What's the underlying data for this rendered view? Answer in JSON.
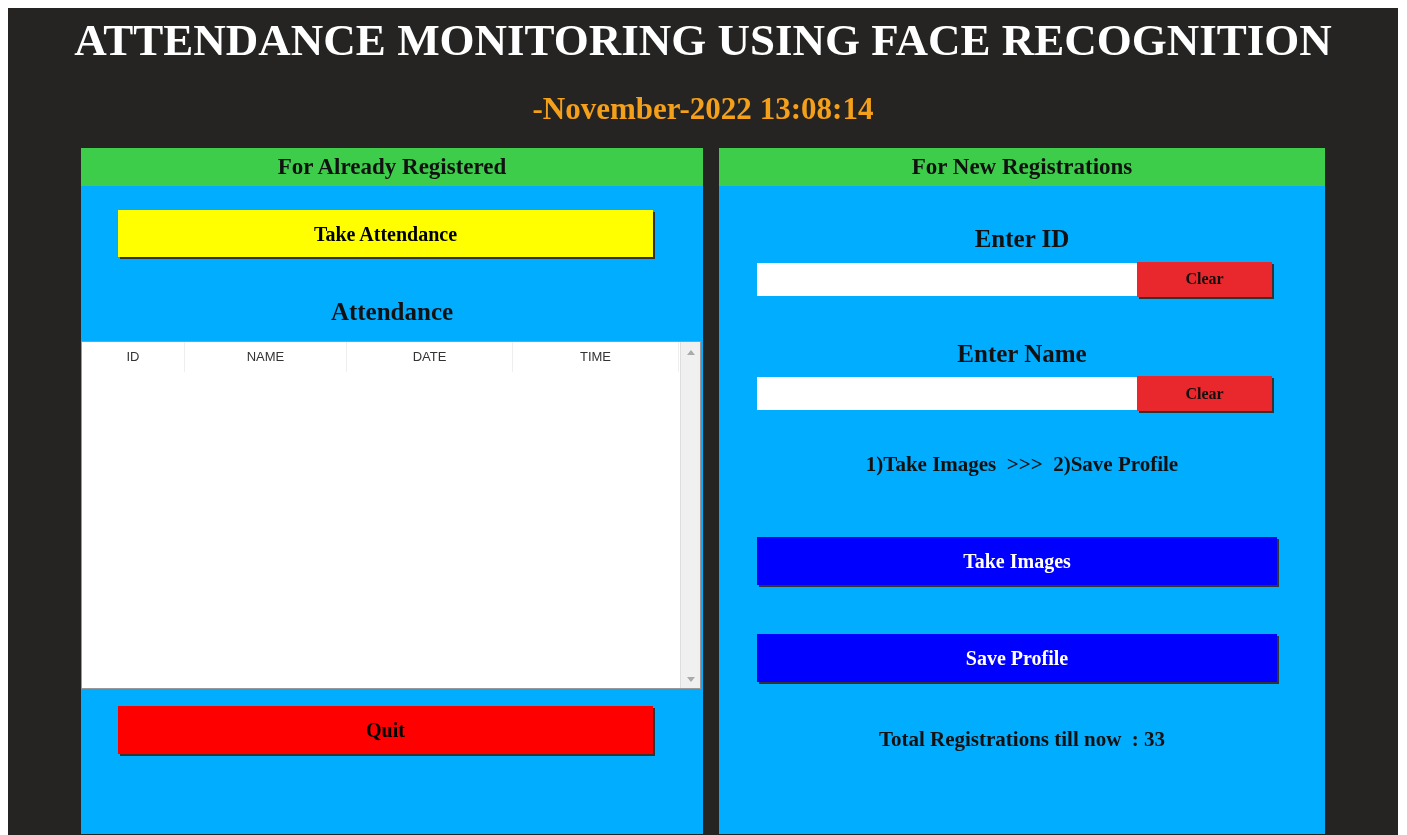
{
  "window": {
    "title": "ATTENDANCE MONITORING USING FACE RECOGNITION"
  },
  "date": "-November-2022",
  "clock": "13:08:14",
  "left_panel": {
    "header": "For Already Registered",
    "take_attendance_button": "Take Attendance",
    "table_title": "Attendance",
    "table": {
      "columns": [
        "ID",
        "NAME",
        "DATE",
        "TIME"
      ]
    },
    "quit_button": "Quit"
  },
  "right_panel": {
    "header": "For New Registrations",
    "fields": [
      {
        "label": "Enter ID",
        "clear_button": "Clear"
      },
      {
        "label": "Enter Name",
        "clear_button": "Clear"
      }
    ],
    "instructions": "1)Take Images  >>>  2)Save Profile",
    "buttons": [
      "Take Images",
      "Save Profile"
    ],
    "total": "Total Registrations till now  : 33"
  }
}
